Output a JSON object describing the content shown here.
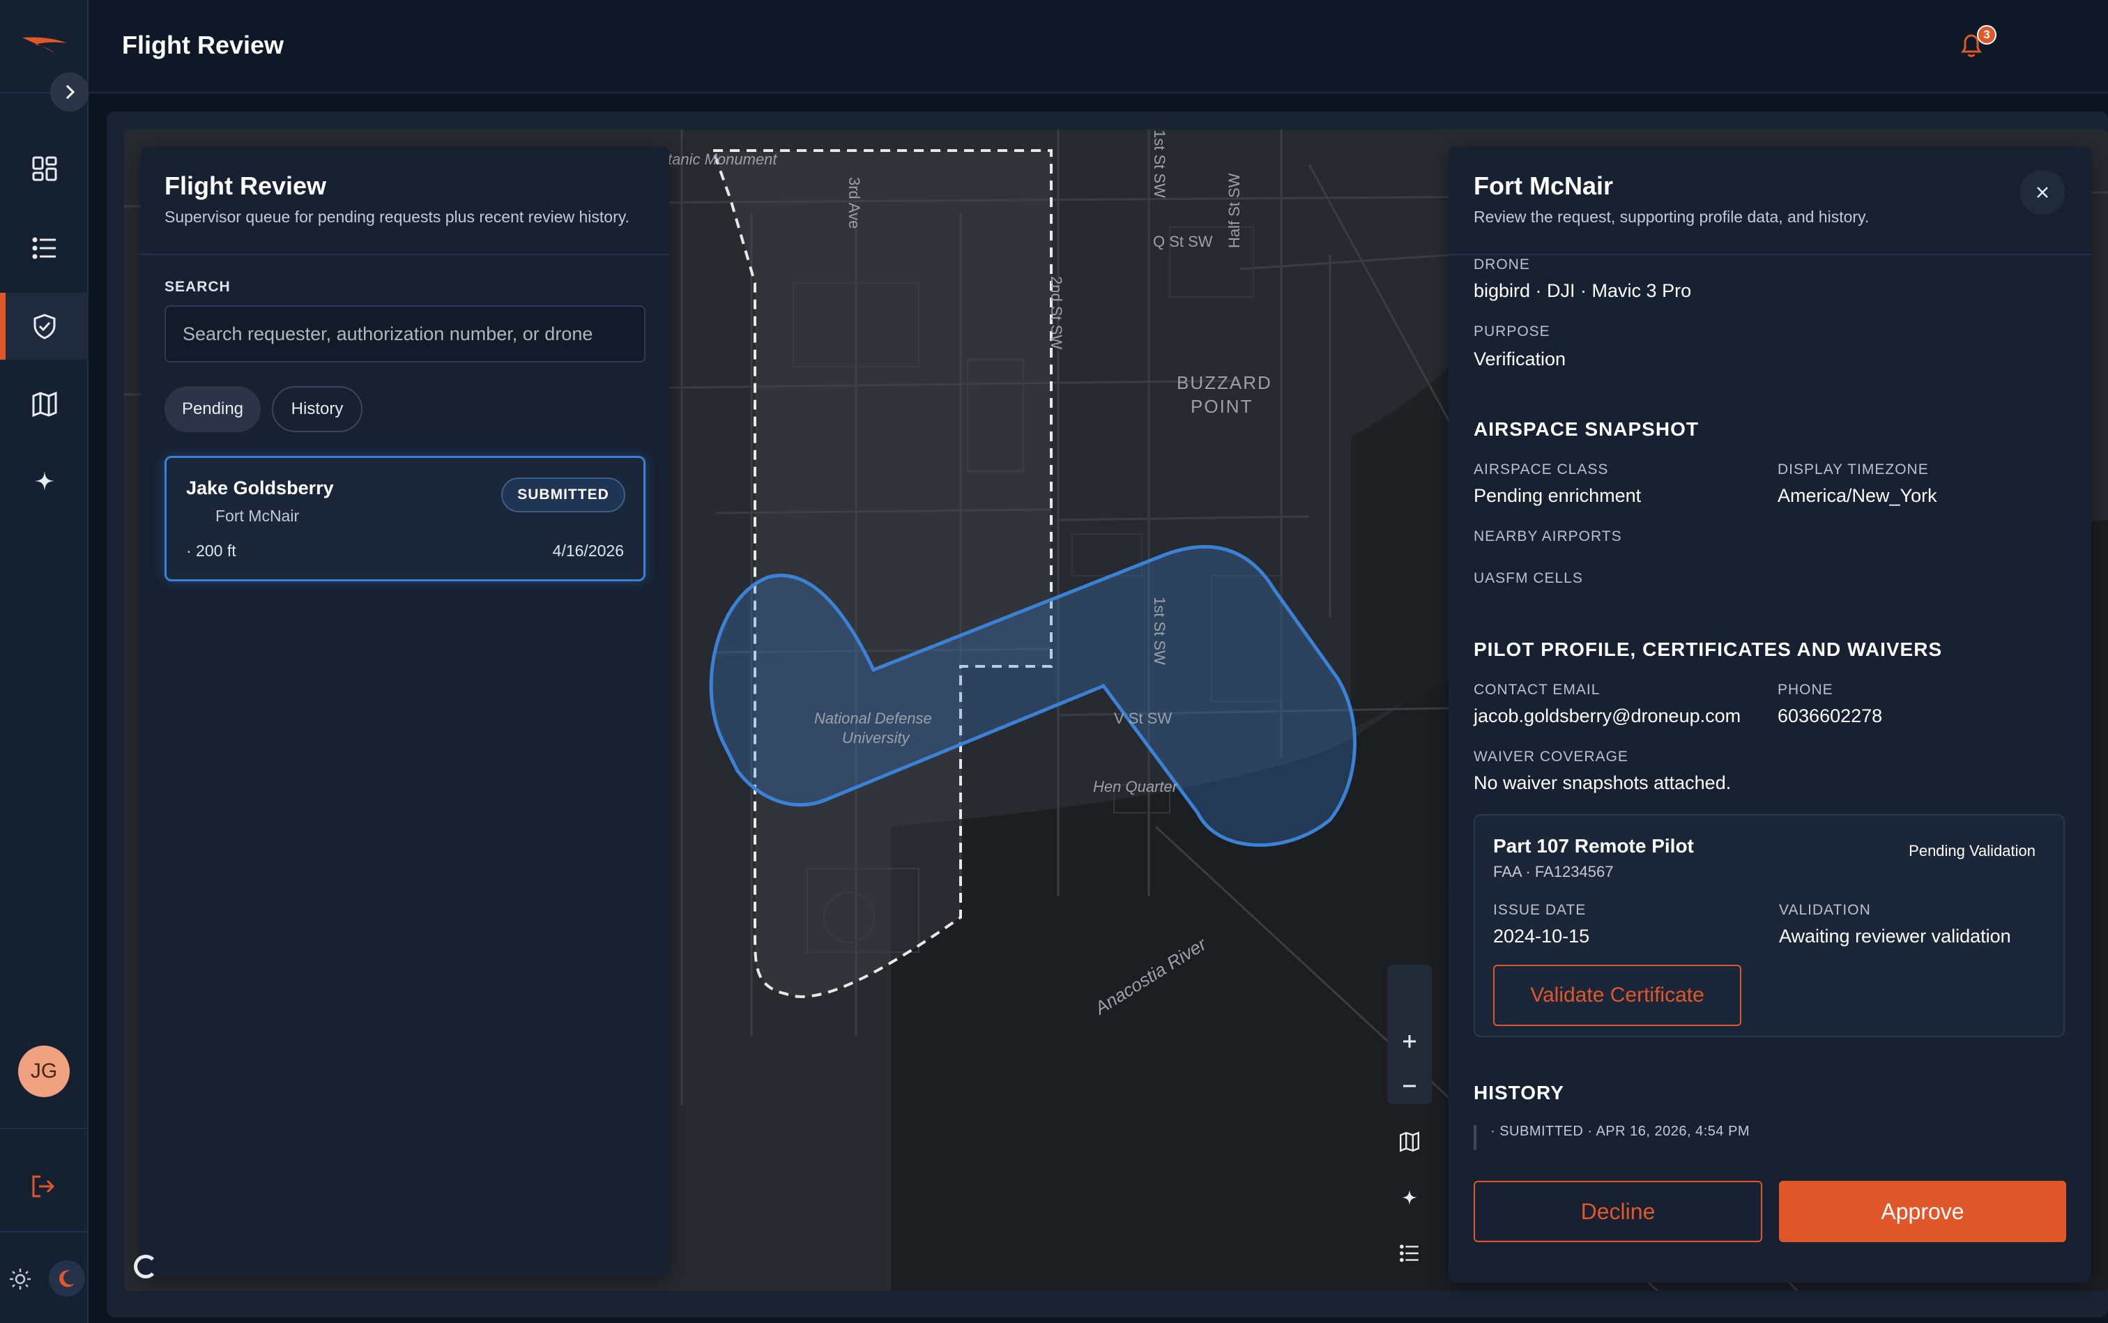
{
  "app": {
    "page_title": "Flight Review",
    "notifications_count": "3",
    "user_initials": "JG"
  },
  "sidebar": {
    "items": [
      {
        "name": "dashboard",
        "icon": "dashboard-icon"
      },
      {
        "name": "list",
        "icon": "list-icon"
      },
      {
        "name": "flight-review",
        "icon": "shield-check-icon",
        "active": true
      },
      {
        "name": "map",
        "icon": "map-icon"
      },
      {
        "name": "ai",
        "icon": "sparkle-icon"
      }
    ]
  },
  "left_panel": {
    "title": "Flight Review",
    "subtitle": "Supervisor queue for pending requests plus recent review history.",
    "search_label": "SEARCH",
    "search_placeholder": "Search requester, authorization number, or drone",
    "tabs": {
      "pending": "Pending",
      "history": "History"
    },
    "request": {
      "name": "Jake Goldsberry",
      "site": "Fort McNair",
      "status": "SUBMITTED",
      "altitude": "· 200 ft",
      "date": "4/16/2026"
    }
  },
  "map": {
    "labels": {
      "monument": "tanic Monument",
      "third_ave": "3rd Ave",
      "q_st": "Q St SW",
      "second_st": "2nd St SW",
      "half_st": "Half St SW",
      "buzzard_1": "BUZZARD",
      "buzzard_2": "POINT",
      "first_st_top": "1st St SW",
      "first_st": "1st St SW",
      "v_st": "V St SW",
      "ndu_1": "National Defense",
      "ndu_2": "University",
      "hen": "Hen Quarter",
      "river": "Anacostia River"
    }
  },
  "detail": {
    "title": "Fort McNair",
    "subtitle": "Review the request, supporting profile data, and history.",
    "drone_label": "DRONE",
    "drone_value": "bigbird · DJI · Mavic 3 Pro",
    "purpose_label": "PURPOSE",
    "purpose_value": "Verification",
    "airspace": {
      "heading": "AIRSPACE SNAPSHOT",
      "class_label": "AIRSPACE CLASS",
      "class_value": "Pending enrichment",
      "tz_label": "DISPLAY TIMEZONE",
      "tz_value": "America/New_York",
      "airports_label": "NEARBY AIRPORTS",
      "uasfm_label": "UASFM CELLS"
    },
    "pilot": {
      "heading": "PILOT PROFILE, CERTIFICATES AND WAIVERS",
      "email_label": "CONTACT EMAIL",
      "email_value": "jacob.goldsberry@droneup.com",
      "phone_label": "PHONE",
      "phone_value": "6036602278",
      "waiver_label": "WAIVER COVERAGE",
      "waiver_value": "No waiver snapshots attached."
    },
    "certificate": {
      "title": "Part 107 Remote Pilot",
      "sub": "FAA · FA1234567",
      "status": "Pending Validation",
      "issue_label": "ISSUE DATE",
      "issue_value": "2024-10-15",
      "validation_label": "VALIDATION",
      "validation_value": "Awaiting reviewer validation",
      "validate_button": "Validate Certificate"
    },
    "history": {
      "heading": "HISTORY",
      "entries": [
        "· SUBMITTED · APR 16, 2026, 4:54 PM"
      ]
    },
    "actions": {
      "decline": "Decline",
      "approve": "Approve"
    }
  },
  "colors": {
    "accent": "#e0572a",
    "selection": "#3b82d6",
    "panel": "#172131"
  }
}
